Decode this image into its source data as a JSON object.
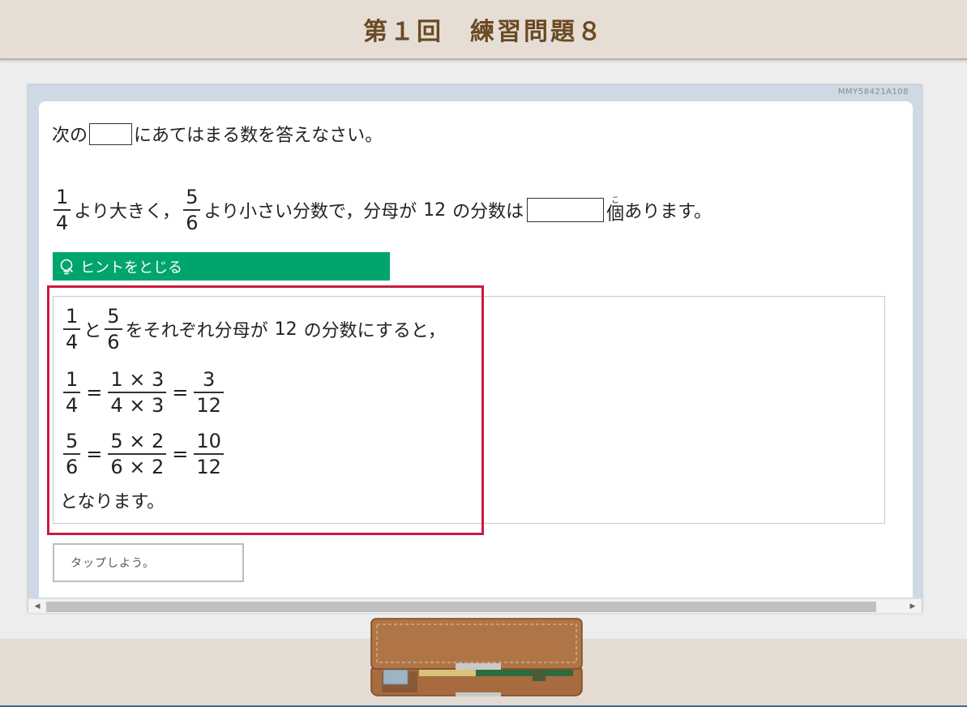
{
  "header": {
    "title": "第１回　練習問題８"
  },
  "problem": {
    "code": "MMY58421A108",
    "instruction_before": "次の",
    "instruction_after": "にあてはまる数を答えなさい。",
    "fraction_a": {
      "num": "1",
      "den": "4"
    },
    "text1": "より大きく，",
    "fraction_b": {
      "num": "5",
      "den": "6"
    },
    "text2": "より小さい分数で，分母が",
    "denominator_value": "12",
    "text3": "の分数は",
    "unit_char": "個",
    "unit_ruby": "こ",
    "text4": "あります。"
  },
  "hint": {
    "toggle_label": "ヒントをとじる",
    "line1": {
      "f1": {
        "num": "1",
        "den": "4"
      },
      "and": "と",
      "f2": {
        "num": "5",
        "den": "6"
      },
      "text_a": "をそれぞれ分母が",
      "value": "12",
      "text_b": "の分数にすると，"
    },
    "eq1": {
      "lhs": {
        "num": "1",
        "den": "4"
      },
      "mid": {
        "num": "1 × 3",
        "den": "4 × 3"
      },
      "rhs": {
        "num": "3",
        "den": "12"
      }
    },
    "eq2": {
      "lhs": {
        "num": "5",
        "den": "6"
      },
      "mid": {
        "num": "5 × 2",
        "den": "6 × 2"
      },
      "rhs": {
        "num": "10",
        "den": "12"
      }
    },
    "equals": "=",
    "closing": "となります。"
  },
  "answer": {
    "tap_label": "タップしよう。"
  },
  "colors": {
    "header_bg": "#e6ddd5",
    "title_color": "#6a4a22",
    "hint_green": "#00a46f",
    "highlight_red": "#cc1a41",
    "panel_blue": "#cfd9e5"
  }
}
